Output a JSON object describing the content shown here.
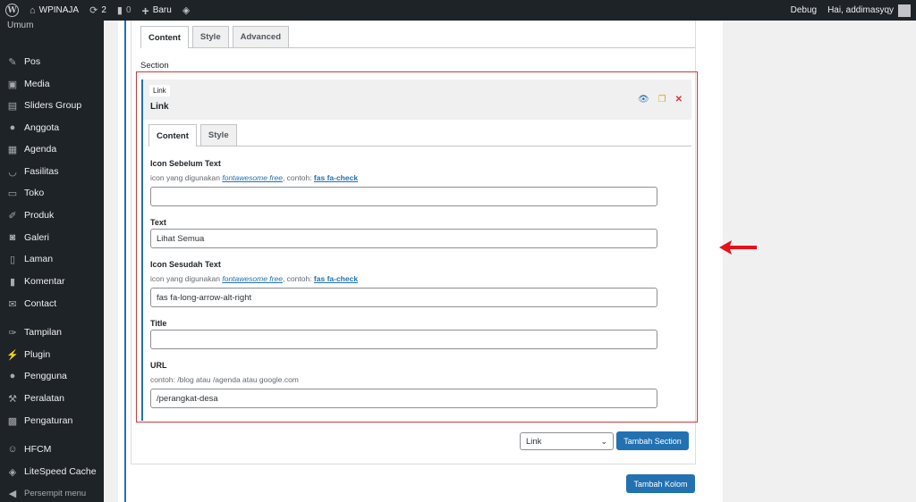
{
  "adminbar": {
    "site_name": "WPINAJA",
    "updates_count": "2",
    "comments_count": "0",
    "new_label": "Baru",
    "debug_label": "Debug",
    "greeting": "Hai, addimasyqy"
  },
  "sidebar": {
    "top_label": "Umum",
    "items": [
      {
        "label": "Pos",
        "icon": "pin-icon"
      },
      {
        "label": "Media",
        "icon": "media-icon"
      },
      {
        "label": "Sliders Group",
        "icon": "slider-icon"
      },
      {
        "label": "Anggota",
        "icon": "user-icon"
      },
      {
        "label": "Agenda",
        "icon": "calendar-icon"
      },
      {
        "label": "Fasilitas",
        "icon": "smile-icon"
      },
      {
        "label": "Toko",
        "icon": "store-icon"
      },
      {
        "label": "Produk",
        "icon": "carrot-icon"
      },
      {
        "label": "Galeri",
        "icon": "camera-icon"
      },
      {
        "label": "Laman",
        "icon": "page-icon"
      },
      {
        "label": "Komentar",
        "icon": "comment-icon"
      },
      {
        "label": "Contact",
        "icon": "mail-icon"
      },
      {
        "label": "Tampilan",
        "icon": "brush-icon"
      },
      {
        "label": "Plugin",
        "icon": "plug-icon"
      },
      {
        "label": "Pengguna",
        "icon": "users-icon"
      },
      {
        "label": "Peralatan",
        "icon": "wrench-icon"
      },
      {
        "label": "Pengaturan",
        "icon": "settings-icon"
      },
      {
        "label": "HFCM",
        "icon": "robot-icon"
      },
      {
        "label": "LiteSpeed Cache",
        "icon": "diamond-icon"
      },
      {
        "label": "Persempit menu",
        "icon": "collapse-icon"
      }
    ]
  },
  "outer_tabs": [
    "Content",
    "Style",
    "Advanced"
  ],
  "section_label": "Section",
  "block": {
    "badge": "Link",
    "title": "Link",
    "tabs": [
      "Content",
      "Style"
    ],
    "fields": {
      "icon_before": {
        "label": "Icon Sebelum Text",
        "help_prefix": "icon yang digunakan",
        "help_link": "fontawesome free",
        "help_mid": ", contoh:",
        "help_example": "fas fa-check",
        "value": ""
      },
      "text": {
        "label": "Text",
        "value": "Lihat Semua"
      },
      "icon_after": {
        "label": "Icon Sesudah Text",
        "help_prefix": "icon yang digunakan",
        "help_link": "fontawesome free",
        "help_mid": ", contoh:",
        "help_example": "fas fa-check",
        "value": "fas fa-long-arrow-alt-right"
      },
      "title": {
        "label": "Title",
        "value": ""
      },
      "url": {
        "label": "URL",
        "help": "contoh: /blog atau /agenda atau google.com",
        "value": "/perangkat-desa"
      }
    }
  },
  "section_type_select": {
    "selected": "Link"
  },
  "buttons": {
    "add_section": "Tambah Section",
    "add_column": "Tambah Kolom"
  },
  "colors": {
    "accent": "#2271b1",
    "highlight": "#d63638",
    "sidebar_bg": "#1d2327"
  }
}
